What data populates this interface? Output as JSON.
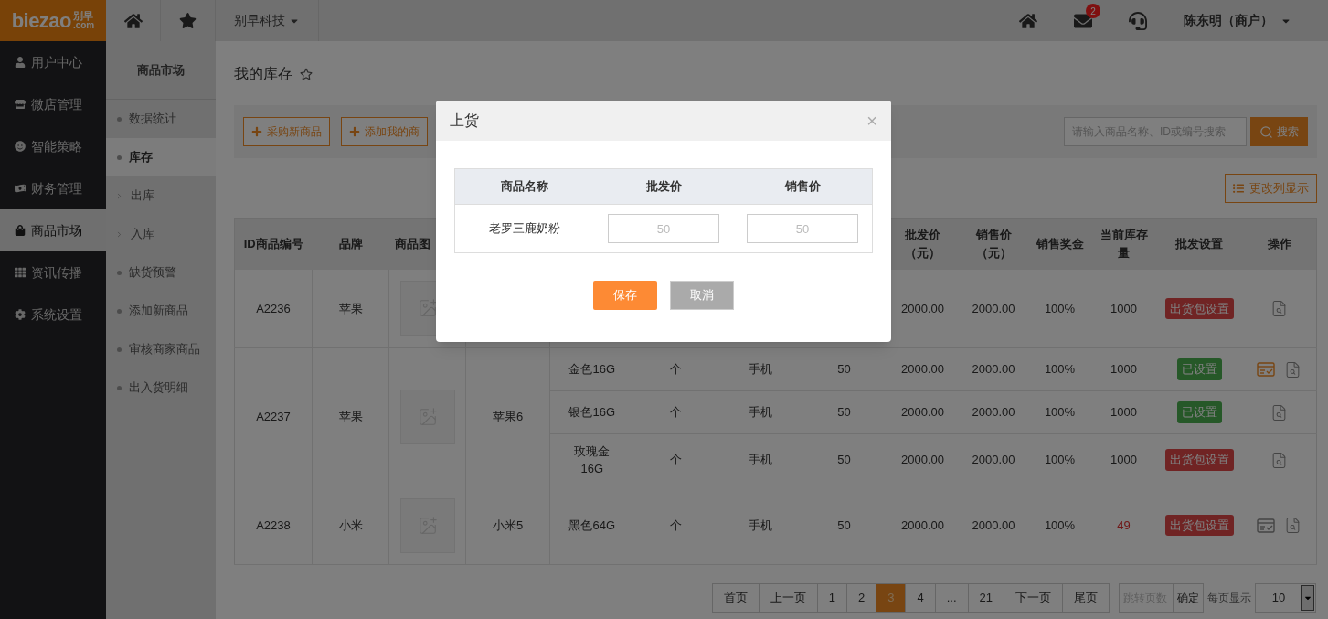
{
  "topbar": {
    "logo": {
      "latin": "biezao",
      "chinese": "别早",
      "domain": ".com"
    },
    "company": "别早科技",
    "mail_badge": "2",
    "user": "陈东明（商户）"
  },
  "sidebar": {
    "items": [
      {
        "label": "用户中心",
        "selected": false
      },
      {
        "label": "微店管理",
        "selected": false
      },
      {
        "label": "智能策略",
        "selected": false
      },
      {
        "label": "财务管理",
        "selected": false
      },
      {
        "label": "商品市场",
        "selected": true
      },
      {
        "label": "资讯传播",
        "selected": false
      },
      {
        "label": "系统设置",
        "selected": false
      }
    ]
  },
  "submenu": {
    "title": "商品市场",
    "items": [
      {
        "label": "数据统计",
        "kind": "dot",
        "selected": false
      },
      {
        "label": "库存",
        "kind": "dot",
        "selected": true
      },
      {
        "label": "出库",
        "kind": "arrow",
        "selected": false
      },
      {
        "label": "入库",
        "kind": "arrow",
        "selected": false
      },
      {
        "label": "缺货预警",
        "kind": "dot",
        "selected": false
      },
      {
        "label": "添加新商品",
        "kind": "dot",
        "selected": false
      },
      {
        "label": "审核商家商品",
        "kind": "dot",
        "selected": false
      },
      {
        "label": "出入货明细",
        "kind": "dot",
        "selected": false
      }
    ]
  },
  "page": {
    "title": "我的库存",
    "toolbar_buttons": [
      "采购新商品",
      "添加我的商"
    ],
    "search": {
      "placeholder": "请输入商品名称、ID或编号搜索",
      "button": "搜索"
    },
    "column_button": "更改列显示"
  },
  "table": {
    "columns": [
      {
        "label": "ID商品编号"
      },
      {
        "label": "品牌"
      },
      {
        "label": "商品图"
      },
      {},
      {},
      {},
      {},
      {},
      {
        "label": "批发价（元）"
      },
      {
        "label": "销售价（元）"
      },
      {
        "label": "销售奖金"
      },
      {
        "label": "当前库存量"
      },
      {
        "label": "批发设置"
      },
      {
        "label": "操作"
      }
    ],
    "rows": [
      {
        "id": "A2236",
        "brand": "苹果",
        "variants": [
          {
            "wholesale": "2000.00",
            "retail": "2000.00",
            "bonus": "100%",
            "stock": "1000",
            "low": false,
            "setting": {
              "label": "出货包设置",
              "kind": "unset"
            },
            "actions": [
              {
                "kind": "view"
              }
            ]
          }
        ]
      },
      {
        "id": "A2237",
        "brand": "苹果",
        "model": "苹果6",
        "variants": [
          {
            "spec": "金色16G",
            "unit": "个",
            "category": "手机",
            "qty": "50",
            "wholesale": "2000.00",
            "retail": "2000.00",
            "bonus": "100%",
            "stock": "1000",
            "low": false,
            "setting": {
              "label": "已设置",
              "kind": "set"
            },
            "actions": [
              {
                "kind": "checklist",
                "active": true
              },
              {
                "kind": "view"
              }
            ]
          },
          {
            "spec": "银色16G",
            "unit": "个",
            "category": "手机",
            "qty": "50",
            "wholesale": "2000.00",
            "retail": "2000.00",
            "bonus": "100%",
            "stock": "1000",
            "low": false,
            "setting": {
              "label": "已设置",
              "kind": "set"
            },
            "actions": [
              {
                "kind": "view"
              }
            ]
          },
          {
            "spec": "玫瑰金16G",
            "unit": "个",
            "category": "手机",
            "qty": "50",
            "wholesale": "2000.00",
            "retail": "2000.00",
            "bonus": "100%",
            "stock": "1000",
            "low": false,
            "setting": {
              "label": "出货包设置",
              "kind": "unset"
            },
            "actions": [
              {
                "kind": "view"
              }
            ]
          }
        ]
      },
      {
        "id": "A2238",
        "brand": "小米",
        "model": "小米5",
        "variants": [
          {
            "spec": "黑色64G",
            "unit": "个",
            "category": "手机",
            "qty": "50",
            "wholesale": "2000.00",
            "retail": "2000.00",
            "bonus": "100%",
            "stock": "49",
            "low": true,
            "setting": {
              "label": "出货包设置",
              "kind": "unset"
            },
            "actions": [
              {
                "kind": "checklist",
                "active": false
              },
              {
                "kind": "view"
              }
            ]
          }
        ]
      }
    ]
  },
  "pagination": {
    "pages": [
      {
        "label": "首页",
        "selected": false
      },
      {
        "label": "上一页",
        "selected": false
      },
      {
        "label": "1",
        "selected": false
      },
      {
        "label": "2",
        "selected": false
      },
      {
        "label": "3",
        "selected": true
      },
      {
        "label": "4",
        "selected": false
      },
      {
        "label": "...",
        "selected": false
      },
      {
        "label": "21",
        "selected": false
      },
      {
        "label": "下一页",
        "selected": false
      },
      {
        "label": "尾页",
        "selected": false
      }
    ],
    "jump_placeholder": "跳转页数",
    "confirm": "确定",
    "per_page_label": "每页显示",
    "per_page": "10"
  },
  "modal": {
    "title": "上货",
    "close": "×",
    "columns": [
      "商品名称",
      "批发价",
      "销售价"
    ],
    "row": {
      "name": "老罗三鹿奶粉",
      "wholesale_placeholder": "50",
      "retail_placeholder": "50"
    },
    "buttons": {
      "save": "保存",
      "cancel": "取消"
    }
  }
}
